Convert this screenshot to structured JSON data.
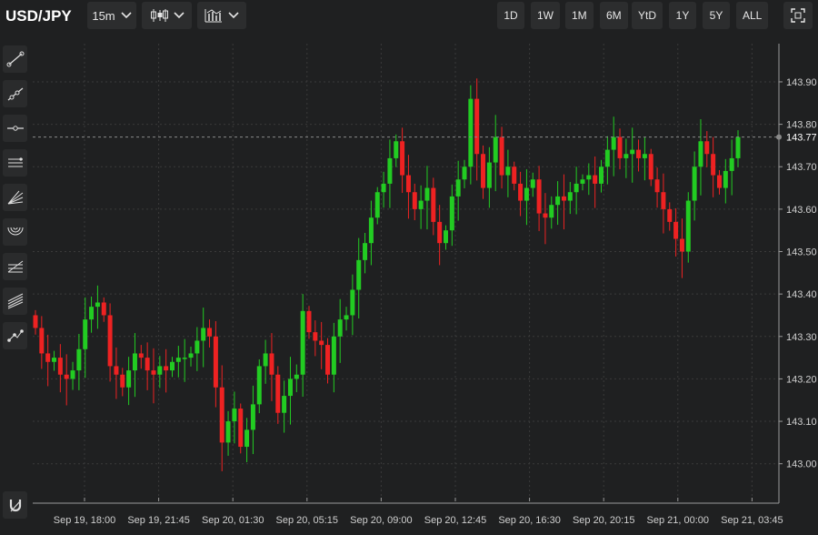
{
  "header": {
    "symbol": "USD/JPY",
    "interval": "15m",
    "chart_type_icon": "candlestick-icon",
    "indicators_icon": "indicators-icon",
    "ranges": [
      "1D",
      "1W",
      "1M",
      "6M",
      "YtD",
      "1Y",
      "5Y",
      "ALL"
    ],
    "fullscreen_icon": "fullscreen-icon"
  },
  "tools": [
    "trend-line-icon",
    "ray-line-icon",
    "horizontal-line-icon",
    "parallel-channel-icon",
    "fan-lines-icon",
    "arc-icon",
    "fibonacci-icon",
    "regression-channel-icon",
    "path-icon",
    "magnet-icon"
  ],
  "colors": {
    "up": "#22cc22",
    "down": "#ee2222",
    "background": "#1f2021",
    "grid": "#3a3a3a"
  },
  "chart_data": {
    "type": "candlestick",
    "title": "",
    "xlabel": "",
    "ylabel": "",
    "ylim": [
      142.92,
      143.99
    ],
    "grid": true,
    "current_price": "143.77",
    "y_ticks": [
      "143.00",
      "143.10",
      "143.20",
      "143.30",
      "143.40",
      "143.50",
      "143.60",
      "143.70",
      "143.80",
      "143.90"
    ],
    "x_ticks": [
      "Sep 19, 18:00",
      "Sep 19, 21:45",
      "Sep 20, 01:30",
      "Sep 20, 05:15",
      "Sep 20, 09:00",
      "Sep 20, 12:45",
      "Sep 20, 16:30",
      "Sep 20, 20:15",
      "Sep 21, 00:00",
      "Sep 21, 03:45"
    ],
    "series_close": [
      143.32,
      143.26,
      143.24,
      143.25,
      143.21,
      143.2,
      143.22,
      143.27,
      143.34,
      143.37,
      143.38,
      143.35,
      143.23,
      143.21,
      143.18,
      143.22,
      143.26,
      143.25,
      143.22,
      143.21,
      143.23,
      143.22,
      143.24,
      143.25,
      143.25,
      143.26,
      143.29,
      143.32,
      143.3,
      143.18,
      143.05,
      143.1,
      143.13,
      143.04,
      143.08,
      143.14,
      143.23,
      143.26,
      143.21,
      143.12,
      143.16,
      143.2,
      143.21,
      143.36,
      143.31,
      143.29,
      143.28,
      143.21,
      143.3,
      143.34,
      143.35,
      143.41,
      143.48,
      143.52,
      143.58,
      143.64,
      143.66,
      143.72,
      143.76,
      143.68,
      143.64,
      143.6,
      143.62,
      143.65,
      143.57,
      143.52,
      143.55,
      143.63,
      143.67,
      143.7,
      143.86,
      143.73,
      143.65,
      143.71,
      143.77,
      143.68,
      143.7,
      143.66,
      143.62,
      143.65,
      143.67,
      143.59,
      143.58,
      143.61,
      143.63,
      143.62,
      143.64,
      143.66,
      143.67,
      143.68,
      143.66,
      143.7,
      143.74,
      143.77,
      143.72,
      143.73,
      143.74,
      143.72,
      143.73,
      143.67,
      143.64,
      143.6,
      143.57,
      143.53,
      143.5,
      143.62,
      143.7,
      143.76,
      143.73,
      143.68,
      143.65,
      143.69,
      143.72,
      143.77
    ]
  }
}
